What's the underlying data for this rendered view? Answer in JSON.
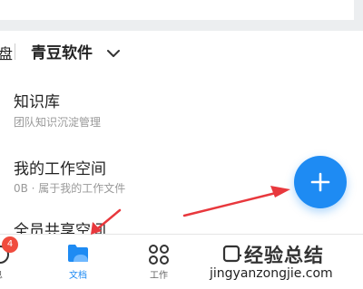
{
  "header": {
    "left_fragment": "盘",
    "title": "青豆软件"
  },
  "items": [
    {
      "title": "知识库",
      "subtitle": "团队知识沉淀管理"
    },
    {
      "title": "我的工作空间",
      "subtitle": "0B · 属于我的工作文件"
    },
    {
      "title": "全员共享空间",
      "subtitle": ""
    }
  ],
  "fab": {
    "icon": "plus-icon"
  },
  "tabbar": {
    "tabs": [
      {
        "label": "息",
        "icon": "message-icon",
        "badge": "4",
        "active": false
      },
      {
        "label": "文档",
        "icon": "folder-icon",
        "active": true
      },
      {
        "label": "工作",
        "icon": "apps-grid-icon",
        "active": false
      }
    ]
  },
  "watermark": {
    "text": "经验总结",
    "url": "jingyanzongjie.com"
  },
  "colors": {
    "accent": "#1e8bf3",
    "badge": "#f04c3e",
    "annotation": "#e8383d"
  }
}
